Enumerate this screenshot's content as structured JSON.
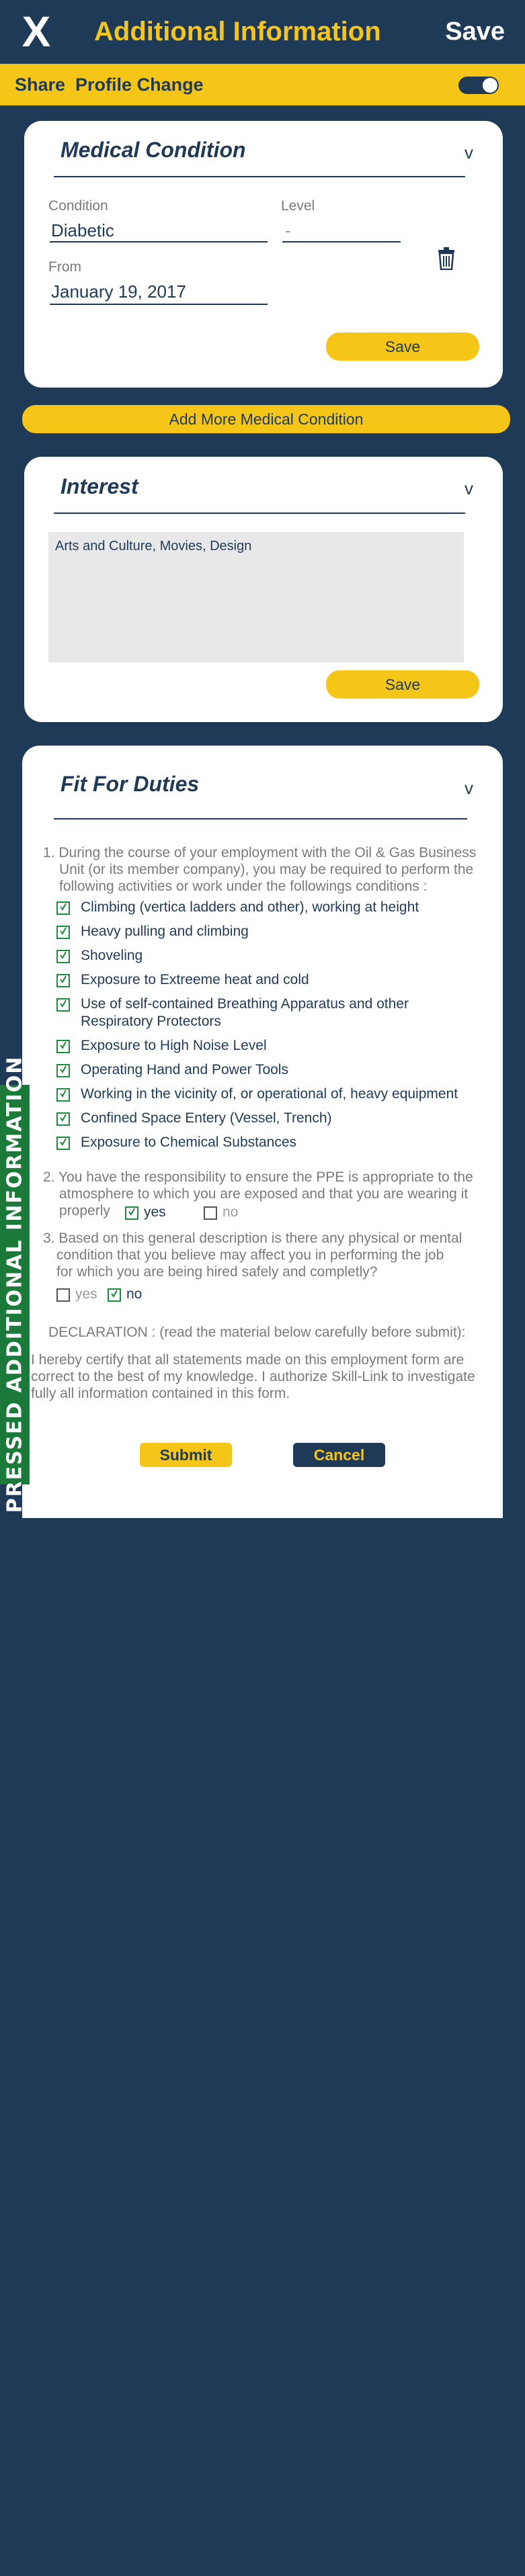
{
  "header": {
    "close_glyph": "X",
    "title": "Additional Information",
    "save_label": "Save"
  },
  "share_bar": {
    "label": "Share  Profile Change",
    "toggle_on": true
  },
  "medical": {
    "title": "Medical Condition",
    "chevron": "v",
    "condition_label": "Condition",
    "condition_value": "Diabetic",
    "level_label": "Level",
    "level_value": "-",
    "from_label": "From",
    "from_value": "January 19, 2017",
    "save_label": "Save"
  },
  "add_more_label": "Add More Medical Condition",
  "interest": {
    "title": "Interest",
    "chevron": "v",
    "text": "Arts and Culture, Movies, Design",
    "save_label": "Save"
  },
  "fit": {
    "title": "Fit For Duties",
    "chevron": "v",
    "q1": [
      "1. During the course of your employment with the Oil & Gas Business",
      "Unit (or its member company), you may be required to perform the",
      "following activities or work under the followings conditions :"
    ],
    "activities": [
      [
        "Climbing (vertica ladders and other), working at height"
      ],
      [
        "Heavy pulling and climbing"
      ],
      [
        "Shoveling"
      ],
      [
        "Exposure to Extreeme heat and cold"
      ],
      [
        "Use of self-contained Breathing Apparatus and other",
        "Respiratory Protectors"
      ],
      [
        "Exposure to High Noise Level"
      ],
      [
        "Operating Hand and Power Tools"
      ],
      [
        "Working in the vicinity of, or operational of, heavy equipment"
      ],
      [
        "Confined Space Entery (Vessel, Trench)"
      ],
      [
        "Exposure to Chemical Substances"
      ]
    ],
    "q2": [
      "2. You have the responsibility to ensure the PPE is appropriate to the",
      "atmosphere to which you are exposed and that you are wearing it",
      "properly"
    ],
    "q2_yes": "yes",
    "q2_no": "no",
    "q2_answer": "yes",
    "q3": [
      "3. Based on this general description is there any physical or mental",
      "condition that you believe may affect you in performing the job",
      "for which you are being hired safely and completly?"
    ],
    "q3_yes": "yes",
    "q3_no": "no",
    "q3_answer": "no",
    "declaration_title": "DECLARATION : (read the material below carefully before submit):",
    "declaration_text": [
      "I hereby certify that all statements made on this employment form are",
      "correct to the best of my knowledge. I authorize Skill-Link to investigate",
      "fully all information contained in this form."
    ],
    "submit_label": "Submit",
    "cancel_label": "Cancel"
  },
  "side_tag": "PRESSED ADDITIONAL INFORMATION",
  "colors": {
    "navy": "#1f3a57",
    "yellow": "#f5c518",
    "green": "#1b7a3a"
  }
}
